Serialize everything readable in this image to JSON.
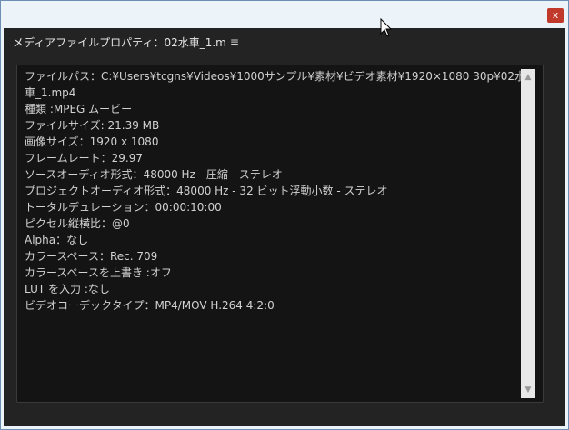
{
  "window": {
    "close_glyph": "x"
  },
  "panel": {
    "title": "メディアファイルプロパティ：02水車_1.m",
    "menu_glyph": "≡"
  },
  "properties": [
    "ファイルパス：C:¥Users¥tcgns¥Videos¥1000サンプル¥素材¥ビデオ素材¥1920×1080 30p¥02水",
    "車_1.mp4",
    "種類 :MPEG ムービー",
    "ファイルサイズ: 21.39 MB",
    "画像サイズ：1920 x 1080",
    "フレームレート：29.97",
    "ソースオーディオ形式：48000 Hz - 圧縮 - ステレオ",
    "プロジェクトオーディオ形式：48000 Hz - 32 ビット浮動小数 - ステレオ",
    "トータルデュレーション：00:00:10:00",
    "ピクセル縦横比：@0",
    "Alpha：なし",
    "カラースペース：Rec. 709",
    "カラースペースを上書き :オフ",
    "LUT を入力 :なし",
    "ビデオコーデックタイプ：MP4/MOV H.264 4:2:0"
  ],
  "scrollbar": {
    "up_glyph": "▲",
    "down_glyph": "▼"
  },
  "colors": {
    "panel_bg": "#232323",
    "content_bg": "#141414",
    "text": "#d2d2d2",
    "close_button": "#c0392b"
  }
}
